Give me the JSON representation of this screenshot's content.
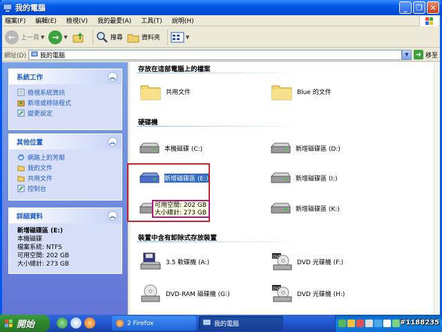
{
  "window": {
    "title": "我的電腦"
  },
  "menu": [
    "檔案(F)",
    "編輯(E)",
    "檢視(V)",
    "我的最愛(A)",
    "工具(T)",
    "說明(H)"
  ],
  "toolbar": {
    "back": "上一頁",
    "search": "搜尋",
    "folders": "資料夾"
  },
  "address": {
    "label": "網址(D)",
    "value": "我的電腦",
    "go": "移至"
  },
  "tasks": {
    "system": {
      "title": "系統工作",
      "items": [
        "檢視系統資訊",
        "新增或移除程式",
        "變更設定"
      ]
    },
    "other": {
      "title": "其他位置",
      "items": [
        "網路上的芳鄰",
        "我的文件",
        "共用文件",
        "控制台"
      ]
    },
    "details": {
      "title": "詳細資料",
      "name": "新增磁碟區 (E:)",
      "type": "本機磁碟",
      "fs": "檔案系統: NTFS",
      "free": "可用空間: 202 GB",
      "total": "大小總計: 273 GB"
    }
  },
  "sections": {
    "files": "存放在這部電腦上的檔案",
    "drives": "硬碟機",
    "removable": "裝置中含有卸除式存放裝置"
  },
  "files": [
    "共用文件",
    "Blue 的文件"
  ],
  "drives": [
    "本機磁碟 (C:)",
    "新增磁碟區 (D:)",
    "新增磁碟區 (E:)",
    "新增磁碟區 (I:)",
    "新增磁碟區 (K:)"
  ],
  "removable": [
    "3.5 軟碟機 (A:)",
    "DVD 光碟機 (F:)",
    "DVD-RAM 磁碟機 (G:)",
    "DVD 光碟機 (H:)"
  ],
  "tooltip": {
    "free": "可用空間: 202 GB",
    "total": "大小總計: 273 GB"
  },
  "taskbar": {
    "start": "開始",
    "task1": "2 Firefox",
    "task2": "我的電腦",
    "watermark": "#1188235"
  }
}
